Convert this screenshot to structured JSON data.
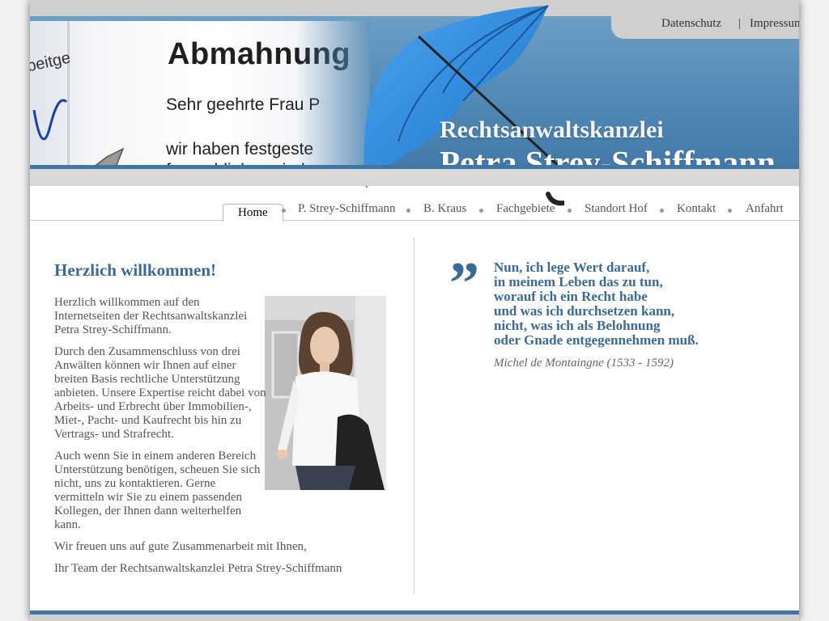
{
  "header": {
    "top_links": {
      "datenschutz": "Datenschutz",
      "separator": "|",
      "impressum": "Impressum"
    },
    "banner": {
      "firm_label": "Rechtsanwaltskanzlei",
      "firm_name": "Petra Strey-Schiffmann",
      "letter_heading": "Abmahnung",
      "letter_greeting": "Sehr geehrte Frau P",
      "letter_line1": "wir haben festgeste",
      "letter_line2": "ferngeblieben sind.",
      "letter_fragment": "beitge",
      "umbrella_color": "#2f86d9"
    }
  },
  "nav": {
    "items": [
      {
        "label": "Home",
        "active": true
      },
      {
        "label": "P. Strey-Schiffmann"
      },
      {
        "label": "B. Kraus"
      },
      {
        "label": "Fachgebiete"
      },
      {
        "label": "Standort Hof"
      },
      {
        "label": "Kontakt"
      },
      {
        "label": "Anfahrt"
      }
    ]
  },
  "main": {
    "title": "Herzlich willkommen!",
    "paragraphs": [
      "Herzlich willkommen auf den Internetseiten der Rechtsanwaltskanzlei Petra Strey-Schiffmann.",
      "Durch den Zusammenschluss von drei Anwälten können wir Ihnen auf einer breiten Basis rechtliche Unterstützung anbieten. Unsere Expertise reicht dabei von Arbeits- und Erbrecht über Immobilien-, Miet-, Pacht- und Kaufrecht bis hin zu Vertrags- und Strafrecht.",
      "Auch wenn Sie in einem anderen Bereich Unterstützung benötigen, scheuen Sie sich nicht, uns zu kontaktieren. Gerne vermitteln wir Sie zu einem passenden Kollegen, der Ihnen dann weiterhelfen kann.",
      "Wir freuen uns auf gute Zusammenarbeit mit Ihnen,",
      "Ihr Team der Rechtsanwaltskanzlei Petra Strey-Schiffmann"
    ]
  },
  "quote": {
    "mark": "”",
    "lines": [
      "Nun, ich lege Wert darauf,",
      "in meinem Leben das zu tun,",
      "worauf ich ein Recht habe",
      "und was ich durchsetzen kann,",
      "nicht, was ich als Belohnung",
      "oder Gnade entgegennehmen muß."
    ],
    "author": "Michel de Montaingne (1533 - 1592)"
  },
  "colors": {
    "accent": "#3a6b96",
    "banner_blue": "#4f86b3",
    "text": "#555555"
  }
}
